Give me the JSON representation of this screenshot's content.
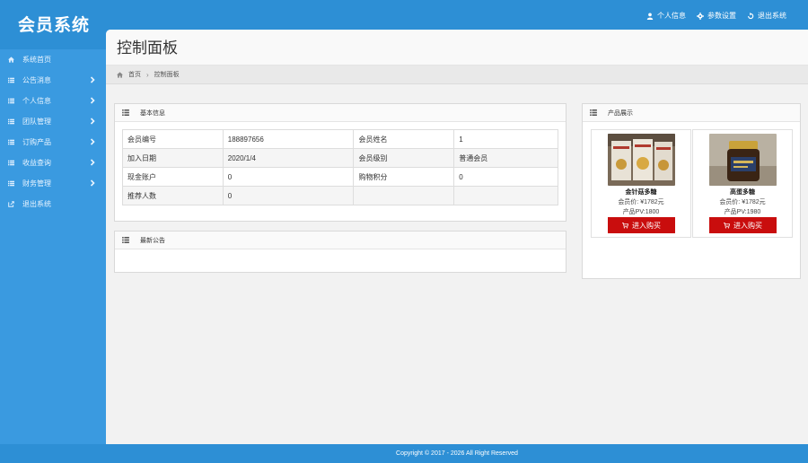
{
  "app": {
    "logo": "会员系统"
  },
  "topnav": [
    {
      "label": "个人信息",
      "icon": "user-icon"
    },
    {
      "label": "参数设置",
      "icon": "gear-icon"
    },
    {
      "label": "退出系统",
      "icon": "logout-icon"
    }
  ],
  "sidebar": {
    "items": [
      {
        "label": "系统首页",
        "icon": "home-icon",
        "has_children": false
      },
      {
        "label": "公告消息",
        "icon": "list-icon",
        "has_children": true
      },
      {
        "label": "个人信息",
        "icon": "list-icon",
        "has_children": true
      },
      {
        "label": "团队管理",
        "icon": "list-icon",
        "has_children": true
      },
      {
        "label": "订购产品",
        "icon": "list-icon",
        "has_children": true
      },
      {
        "label": "收益查询",
        "icon": "list-icon",
        "has_children": true
      },
      {
        "label": "财务管理",
        "icon": "list-icon",
        "has_children": true
      },
      {
        "label": "退出系统",
        "icon": "logout-icon",
        "has_children": false
      }
    ]
  },
  "page": {
    "title": "控制面板",
    "breadcrumb": {
      "home": "首页",
      "current": "控制面板"
    }
  },
  "basic_info": {
    "title": "基本信息",
    "rows": [
      [
        "会员编号",
        "188897656",
        "会员姓名",
        "1"
      ],
      [
        "加入日期",
        "2020/1/4",
        "会员级别",
        "普通会员"
      ],
      [
        "现金账户",
        "0",
        "购物积分",
        "0"
      ],
      [
        "推荐人数",
        "0",
        "",
        ""
      ]
    ]
  },
  "notice": {
    "title": "最新公告"
  },
  "products": {
    "title": "产品展示",
    "items": [
      {
        "name": "金针菇多糖",
        "price": "会员价: ¥1782元",
        "pv": "产品PV:1800",
        "buy": "进入购买",
        "image": "product-box-image"
      },
      {
        "name": "高蛋多糖",
        "price": "会员价: ¥1782元",
        "pv": "产品PV:1980",
        "buy": "进入购买",
        "image": "product-jar-image"
      }
    ]
  },
  "footer": {
    "copyright": "Copyright © 2017 - 2026  All Right Reserved"
  },
  "colors": {
    "primary": "#2d8fd5",
    "sidebar": "#3a9ae0",
    "buy_button": "#c90d0d",
    "content_bg": "#f2f2f2"
  }
}
